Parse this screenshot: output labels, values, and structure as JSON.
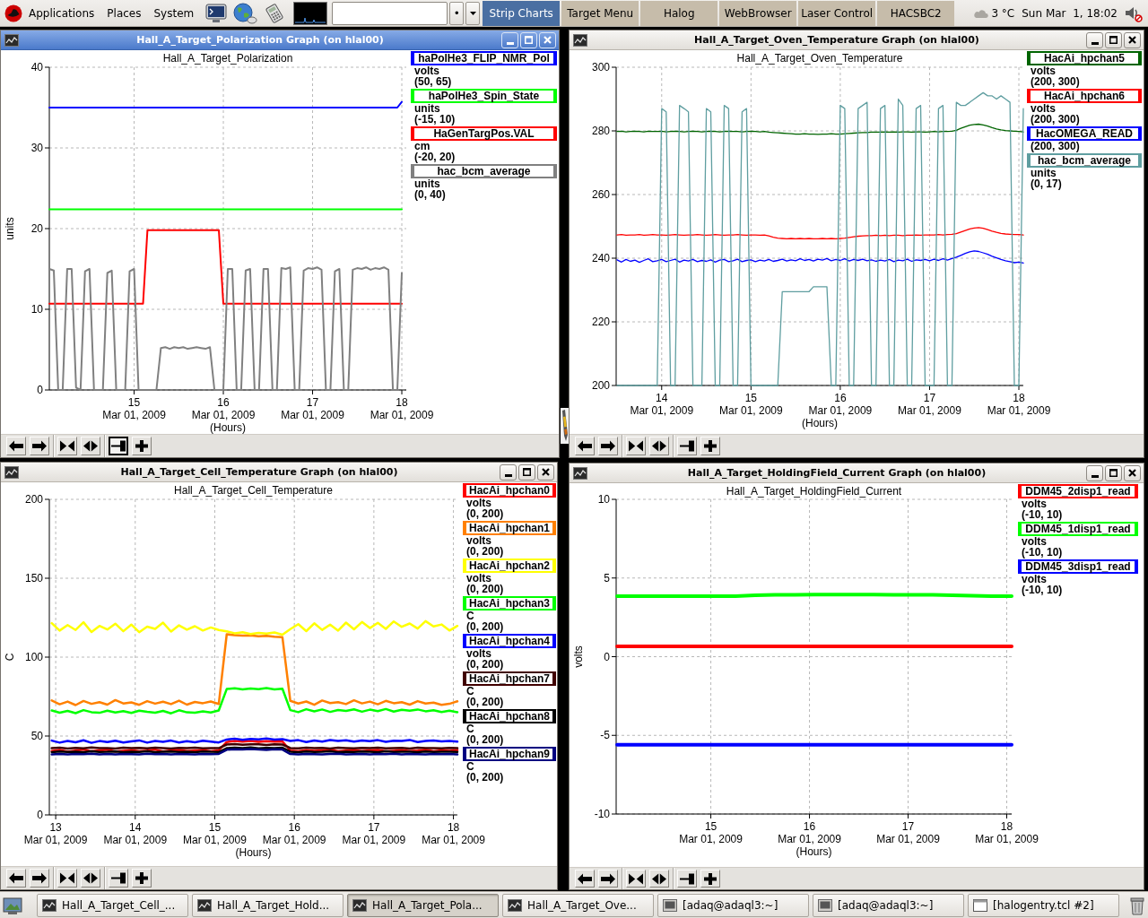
{
  "top_panel": {
    "menus": [
      "Applications",
      "Places",
      "System"
    ],
    "entry_button": "•",
    "workspaces": [
      {
        "label": "Strip Charts",
        "selected": true
      },
      {
        "label": "Target Menu",
        "selected": false
      },
      {
        "label": "Halog",
        "selected": false
      },
      {
        "label": "WebBrowser",
        "selected": false
      },
      {
        "label": "Laser Control",
        "selected": false
      },
      {
        "label": "HACSBC2",
        "selected": false
      }
    ],
    "weather": "3 °C",
    "clock": "Sun Mar  1, 18:02"
  },
  "windows": [
    {
      "title": "Hall_A_Target_Polarization Graph (on hlal00)",
      "active": true,
      "chart_data": {
        "type": "line",
        "title": "Hall_A_Target_Polarization",
        "xlabel": "(Hours)",
        "ylabel": "units",
        "x": [
          14.05,
          14.1,
          14.15,
          14.2,
          14.25,
          14.3,
          14.35,
          14.4,
          14.45,
          14.5,
          14.55,
          14.6,
          14.65,
          14.7,
          14.75,
          14.8,
          14.85,
          14.9,
          14.95,
          15,
          15.05,
          15.1,
          15.15,
          15.2,
          15.25,
          15.3,
          15.35,
          15.4,
          15.45,
          15.5,
          15.55,
          15.6,
          15.65,
          15.7,
          15.75,
          15.8,
          15.85,
          15.9,
          15.95,
          16,
          16.05,
          16.1,
          16.15,
          16.2,
          16.25,
          16.3,
          16.35,
          16.4,
          16.45,
          16.5,
          16.55,
          16.6,
          16.65,
          16.7,
          16.75,
          16.8,
          16.85,
          16.9,
          16.95,
          17,
          17.05,
          17.1,
          17.15,
          17.2,
          17.25,
          17.3,
          17.35,
          17.4,
          17.45,
          17.5,
          17.55,
          17.6,
          17.65,
          17.7,
          17.75,
          17.8,
          17.85,
          17.9,
          17.95,
          18
        ],
        "series": [
          {
            "name": "haPolHe3_FLIP_NMR_Pol",
            "color": "#0000ff",
            "values": [
              35,
              35,
              35,
              35,
              35,
              35,
              35,
              35,
              35,
              35,
              35,
              35,
              35,
              35,
              35,
              35,
              35,
              35,
              35,
              35,
              35,
              35,
              35,
              35,
              35,
              35,
              35,
              35,
              35,
              35,
              35,
              35,
              35,
              35,
              35,
              35,
              35,
              35,
              35,
              35,
              35,
              35,
              35,
              35,
              35,
              35,
              35,
              35,
              35,
              35,
              35,
              35,
              35,
              35,
              35,
              35,
              35,
              35,
              35,
              35,
              35,
              35,
              35,
              35,
              35,
              35,
              35,
              35,
              35,
              35,
              35,
              35,
              35,
              35,
              35,
              35,
              35,
              35,
              35,
              35.7
            ]
          },
          {
            "name": "haPolHe3_Spin_State",
            "color": "#00ff00",
            "values": [
              22.4,
              22.4,
              22.4,
              22.4,
              22.4,
              22.4,
              22.4,
              22.4,
              22.4,
              22.4,
              22.4,
              22.4,
              22.4,
              22.4,
              22.4,
              22.4,
              22.4,
              22.4,
              22.4,
              22.4,
              22.4,
              22.4,
              22.4,
              22.4,
              22.4,
              22.4,
              22.4,
              22.4,
              22.4,
              22.4,
              22.4,
              22.4,
              22.4,
              22.4,
              22.4,
              22.4,
              22.4,
              22.4,
              22.4,
              22.4,
              22.4,
              22.4,
              22.4,
              22.4,
              22.4,
              22.4,
              22.4,
              22.4,
              22.4,
              22.4,
              22.4,
              22.4,
              22.4,
              22.4,
              22.4,
              22.4,
              22.4,
              22.4,
              22.4,
              22.4,
              22.4,
              22.4,
              22.4,
              22.4,
              22.4,
              22.4,
              22.4,
              22.4,
              22.4,
              22.4,
              22.4,
              22.4,
              22.4,
              22.4,
              22.4,
              22.4,
              22.4,
              22.4,
              22.4,
              22.4
            ]
          },
          {
            "name": "HaGenTargPos.VAL",
            "color": "#ff0000",
            "values": [
              10.7,
              10.7,
              10.7,
              10.7,
              10.7,
              10.7,
              10.7,
              10.7,
              10.7,
              10.7,
              10.7,
              10.7,
              10.7,
              10.7,
              10.7,
              10.7,
              10.7,
              10.7,
              10.7,
              10.7,
              10.7,
              10.7,
              19.8,
              19.8,
              19.8,
              19.8,
              19.8,
              19.8,
              19.8,
              19.8,
              19.8,
              19.8,
              19.8,
              19.8,
              19.8,
              19.8,
              19.8,
              19.8,
              19.8,
              10.7,
              10.7,
              10.7,
              10.7,
              10.7,
              10.7,
              10.7,
              10.7,
              10.7,
              10.7,
              10.7,
              10.7,
              10.7,
              10.7,
              10.7,
              10.7,
              10.7,
              10.7,
              10.7,
              10.7,
              10.7,
              10.7,
              10.7,
              10.7,
              10.7,
              10.7,
              10.7,
              10.7,
              10.7,
              10.7,
              10.7,
              10.7,
              10.7,
              10.7,
              10.7,
              10.7,
              10.7,
              10.7,
              10.7,
              10.7,
              10.7
            ]
          },
          {
            "name": "hac_bcm_average",
            "color": "#808080",
            "values": [
              15,
              14.8,
              0,
              0,
              15,
              15,
              0.3,
              0,
              14.7,
              15,
              0,
              0,
              0,
              14.5,
              14.8,
              0,
              0,
              0,
              14.7,
              15,
              0,
              0,
              0,
              0,
              0,
              5.2,
              5.3,
              5.1,
              5.3,
              5.2,
              5.3,
              5.1,
              5.2,
              5.3,
              5.2,
              5.1,
              5.3,
              0,
              0,
              0,
              15,
              15,
              0,
              0,
              14.8,
              15,
              0,
              0,
              15,
              15,
              0,
              0,
              15.1,
              15,
              15.2,
              0,
              0,
              14.8,
              15.1,
              15,
              15.2,
              14.9,
              0,
              0,
              14.7,
              15,
              0,
              0,
              14.9,
              15.1,
              15,
              15.2,
              14.9,
              15.1,
              15,
              15.2,
              14.9,
              0,
              0,
              14.5
            ]
          }
        ],
        "xlim": [
          14.05,
          18.05
        ],
        "ylim": [
          0,
          40
        ],
        "xticks": [
          15,
          16,
          17,
          18
        ],
        "yticks": [
          0,
          10,
          20,
          30,
          40
        ],
        "grid": true
      },
      "tick_dates": [
        "Mar 01, 2009",
        "Mar 01, 2009",
        "Mar 01, 2009",
        "Mar 01, 2009"
      ],
      "legend": [
        {
          "unit": "volts",
          "range": "(50, 65)",
          "selected": false
        },
        {
          "unit": "units",
          "range": "(-15, 10)",
          "selected": false
        },
        {
          "unit": "cm",
          "range": "(-20, 20)",
          "selected": false
        },
        {
          "unit": "units",
          "range": "(0, 40)",
          "selected": true
        }
      ],
      "toolbar": [
        {
          "kind": "pan-left",
          "pressed": false
        },
        {
          "kind": "pan-right",
          "pressed": false
        },
        {
          "kind": "zoom-in",
          "pressed": false
        },
        {
          "kind": "zoom-out",
          "pressed": false
        },
        {
          "kind": "auto-scroll",
          "pressed": true
        },
        {
          "kind": "add",
          "pressed": false
        }
      ]
    },
    {
      "title": "Hall_A_Target_Oven_Temperature Graph (on hlal00)",
      "active": false,
      "chart_data": {
        "type": "line",
        "title": "Hall_A_Target_Oven_Temperature",
        "xlabel": "(Hours)",
        "x": [
          13.5,
          13.55,
          13.6,
          13.65,
          13.7,
          13.75,
          13.8,
          13.85,
          13.9,
          13.95,
          14,
          14.05,
          14.1,
          14.15,
          14.2,
          14.25,
          14.3,
          14.35,
          14.4,
          14.45,
          14.5,
          14.55,
          14.6,
          14.65,
          14.7,
          14.75,
          14.8,
          14.85,
          14.9,
          14.95,
          15,
          15.05,
          15.1,
          15.15,
          15.2,
          15.25,
          15.3,
          15.35,
          15.4,
          15.45,
          15.5,
          15.55,
          15.6,
          15.65,
          15.7,
          15.75,
          15.8,
          15.85,
          15.9,
          15.95,
          16,
          16.05,
          16.1,
          16.15,
          16.2,
          16.25,
          16.3,
          16.35,
          16.4,
          16.45,
          16.5,
          16.55,
          16.6,
          16.65,
          16.7,
          16.75,
          16.8,
          16.85,
          16.9,
          16.95,
          17,
          17.05,
          17.1,
          17.15,
          17.2,
          17.25,
          17.3,
          17.35,
          17.4,
          17.45,
          17.5,
          17.55,
          17.6,
          17.65,
          17.7,
          17.75,
          17.8,
          17.85,
          17.9,
          17.95,
          18,
          18.05
        ],
        "series": [
          {
            "name": "HacAi_hpchan5",
            "color": "#006400",
            "values": [
              279.8,
              279.9,
              279.7,
              279.8,
              279.9,
              279.8,
              279.7,
              279.9,
              279.8,
              279.8,
              279.9,
              279.7,
              279.8,
              279.9,
              279.8,
              279.7,
              279.8,
              279.9,
              279.8,
              279.7,
              279.8,
              279.9,
              279.8,
              279.7,
              279.8,
              279.9,
              279.8,
              279.8,
              279.7,
              279.8,
              279.9,
              279.8,
              279.7,
              279.8,
              279.6,
              279.5,
              279.4,
              279.3,
              279.2,
              279.1,
              279.0,
              279.0,
              279.1,
              279.0,
              279.0,
              278.9,
              279.0,
              279.0,
              279.1,
              279.0,
              279.0,
              279.1,
              279.2,
              279.3,
              279.4,
              279.5,
              279.5,
              279.6,
              279.6,
              279.6,
              279.7,
              279.6,
              279.7,
              279.6,
              279.7,
              279.7,
              279.6,
              279.7,
              279.7,
              279.6,
              279.7,
              279.8,
              279.7,
              279.8,
              279.8,
              279.9,
              280.2,
              280.8,
              281.3,
              281.8,
              282.0,
              282.1,
              281.9,
              281.5,
              281.0,
              280.6,
              280.3,
              280.1,
              280.0,
              279.9,
              279.8,
              279.7
            ]
          },
          {
            "name": "HacAi_hpchan6",
            "color": "#ff0000",
            "values": [
              247.3,
              247.4,
              247.2,
              247.3,
              247.3,
              247.4,
              247.2,
              247.3,
              247.4,
              247.3,
              247.3,
              247.2,
              247.3,
              247.4,
              247.3,
              247.2,
              247.3,
              247.3,
              247.4,
              247.3,
              247.2,
              247.3,
              247.4,
              247.3,
              247.2,
              247.3,
              247.3,
              247.4,
              247.3,
              247.2,
              247.3,
              247.3,
              247.2,
              247.3,
              247.0,
              246.6,
              246.3,
              246.2,
              246.1,
              246.2,
              246.1,
              246.2,
              246.1,
              246.2,
              246.1,
              246.1,
              246.2,
              246.1,
              246.2,
              246.1,
              246.2,
              246.3,
              246.5,
              246.7,
              246.9,
              247.0,
              247.1,
              247.1,
              247.2,
              247.1,
              247.2,
              247.1,
              247.2,
              247.2,
              247.1,
              247.2,
              247.2,
              247.3,
              247.2,
              247.3,
              247.3,
              247.3,
              247.4,
              247.3,
              247.4,
              247.5,
              247.7,
              248.2,
              248.7,
              249.2,
              249.5,
              249.6,
              249.4,
              249.0,
              248.5,
              248.1,
              247.8,
              247.6,
              247.5,
              247.4,
              247.4,
              247.3
            ]
          },
          {
            "name": "HacOMEGA_READ",
            "color": "#0000ff",
            "values": [
              239.5,
              238.8,
              239.6,
              239.0,
              239.4,
              238.7,
              239.3,
              239.8,
              238.9,
              239.2,
              239.6,
              238.9,
              239.3,
              239.7,
              238.8,
              239.4,
              239.1,
              239.6,
              238.9,
              239.3,
              239.0,
              239.5,
              238.8,
              239.4,
              239.6,
              238.9,
              239.2,
              239.7,
              238.9,
              239.3,
              239.5,
              238.9,
              239.4,
              239.1,
              239.6,
              239.0,
              239.3,
              239.7,
              239.1,
              239.5,
              239.2,
              239.8,
              239.3,
              239.6,
              239.1,
              239.7,
              239.4,
              239.9,
              239.2,
              239.6,
              239.3,
              239.8,
              239.1,
              239.6,
              239.3,
              239.7,
              239.2,
              239.5,
              239.0,
              239.4,
              239.1,
              239.6,
              238.9,
              239.4,
              239.2,
              239.7,
              239.0,
              239.5,
              239.3,
              239.6,
              239.2,
              239.7,
              239.3,
              239.8,
              239.4,
              239.9,
              240.3,
              240.9,
              241.5,
              242.0,
              242.3,
              242.1,
              241.7,
              241.2,
              240.6,
              240.1,
              239.6,
              239.2,
              238.9,
              238.6,
              238.8,
              238.5
            ]
          },
          {
            "name": "hac_bcm_average",
            "color": "#5f9ea0",
            "values": [
              200,
              200,
              200,
              200,
              200,
              200,
              200,
              200,
              200,
              200,
              287,
              286,
              200,
              200,
              288,
              287,
              286,
              200,
              200,
              200,
              287,
              286,
              200,
              200,
              288,
              287,
              200,
              200,
              286,
              287,
              200,
              200,
              200,
              200,
              200,
              200,
              200,
              229.5,
              229.5,
              229.5,
              229.5,
              229.5,
              229.5,
              229.5,
              231,
              231,
              231,
              231,
              200,
              200,
              288,
              287,
              200,
              200,
              287,
              288,
              289,
              200,
              200,
              287,
              288,
              200,
              200,
              290,
              288,
              200,
              200,
              287,
              288,
              200,
              200,
              200,
              287,
              288,
              200,
              200,
              289,
              288,
              288,
              289,
              290,
              291,
              292,
              291,
              291,
              290,
              291,
              290,
              289,
              200,
              200,
              287
            ]
          }
        ],
        "xlim": [
          13.49,
          18.05
        ],
        "ylim": [
          200,
          300
        ],
        "xticks": [
          14,
          15,
          16,
          17,
          18
        ],
        "yticks": [
          200,
          220,
          240,
          260,
          280,
          300
        ],
        "grid": true
      },
      "tick_dates": [
        "Mar 01, 2009",
        "Mar 01, 2009",
        "Mar 01, 2009",
        "Mar 01, 2009",
        "Mar 01, 2009"
      ],
      "legend": [
        {
          "unit": "volts",
          "range": "(200, 300)",
          "selected": false
        },
        {
          "unit": "volts",
          "range": "(200, 300)",
          "selected": false
        },
        {
          "range": "(200, 300)",
          "selected": true
        },
        {
          "unit": "units",
          "range": "(0, 17)",
          "selected": false
        }
      ],
      "toolbar": [
        {
          "kind": "pan-left",
          "pressed": false
        },
        {
          "kind": "pan-right",
          "pressed": false
        },
        {
          "kind": "zoom-in",
          "pressed": false
        },
        {
          "kind": "zoom-out",
          "pressed": false
        },
        {
          "kind": "auto-scroll",
          "pressed": false
        },
        {
          "kind": "add",
          "pressed": false
        }
      ]
    },
    {
      "title": "Hall_A_Target_Cell_Temperature Graph (on hlal00)",
      "active": false,
      "chart_data": {
        "type": "line",
        "title": "Hall_A_Target_Cell_Temperature",
        "xlabel": "(Hours)",
        "ylabel": "C",
        "x": [
          12.95,
          13.05,
          13.15,
          13.25,
          13.35,
          13.45,
          13.55,
          13.65,
          13.75,
          13.85,
          13.95,
          14.05,
          14.15,
          14.25,
          14.35,
          14.45,
          14.55,
          14.65,
          14.75,
          14.85,
          14.95,
          15.05,
          15.15,
          15.25,
          15.35,
          15.45,
          15.55,
          15.65,
          15.75,
          15.85,
          15.95,
          16.05,
          16.15,
          16.25,
          16.35,
          16.45,
          16.55,
          16.65,
          16.75,
          16.85,
          16.95,
          17.05,
          17.15,
          17.25,
          17.35,
          17.45,
          17.55,
          17.65,
          17.75,
          17.85,
          17.95,
          18.05
        ],
        "series": [
          {
            "name": "HacAi_hpchan0",
            "color": "#ff0000",
            "values": [
              40.5,
              41.2,
              40.1,
              40.8,
              41.5,
              40.3,
              40.9,
              41.3,
              40.2,
              40.7,
              41.1,
              40.4,
              40.8,
              41.4,
              40.2,
              40.9,
              41.2,
              40.5,
              40.8,
              41.0,
              40.4,
              40.9,
              46.2,
              46.8,
              46.5,
              46.9,
              46.3,
              46.7,
              46.4,
              46.6,
              40.8,
              40.3,
              41.1,
              40.6,
              40.9,
              41.3,
              40.4,
              40.8,
              41.0,
              40.5,
              40.9,
              41.2,
              40.3,
              40.7,
              41.1,
              40.5,
              40.8,
              41.3,
              40.4,
              40.9,
              40.6,
              41.0
            ]
          },
          {
            "name": "HacAi_hpchan1",
            "color": "#ff8000",
            "values": [
              72.5,
              70.1,
              71.8,
              69.6,
              72.2,
              70.4,
              71.5,
              69.9,
              72.8,
              70.6,
              71.3,
              69.8,
              72.1,
              70.5,
              71.7,
              70.2,
              72.4,
              69.9,
              71.6,
              70.8,
              71.9,
              70.3,
              114.5,
              114.0,
              113.6,
              113.8,
              113.2,
              113.5,
              112.9,
              112.6,
              72.3,
              70.6,
              71.9,
              69.8,
              72.5,
              70.9,
              71.4,
              70.2,
              72.6,
              70.7,
              71.8,
              70.1,
              72.3,
              70.8,
              71.5,
              69.9,
              72.1,
              70.6,
              71.2,
              69.7,
              70.4,
              72.0
            ]
          },
          {
            "name": "HacAi_hpchan2",
            "color": "#ffff00",
            "values": [
              121.5,
              116.8,
              120.3,
              117.2,
              122.1,
              115.9,
              119.8,
              117.5,
              121.2,
              116.4,
              120.6,
              115.8,
              119.3,
              117.9,
              121.8,
              116.2,
              120.1,
              117.4,
              119.6,
              116.9,
              118.8,
              117.2,
              116.3,
              115.1,
              115.8,
              114.6,
              115.4,
              114.9,
              115.6,
              114.2,
              117.8,
              120.9,
              116.5,
              121.4,
              117.3,
              120.6,
              116.8,
              121.9,
              117.6,
              122.3,
              118.4,
              121.7,
              117.9,
              122.6,
              119.2,
              121.3,
              118.1,
              122.8,
              119.5,
              120.7,
              116.9,
              119.8
            ]
          },
          {
            "name": "HacAi_hpchan3",
            "color": "#00ff00",
            "values": [
              66.2,
              64.8,
              65.9,
              64.5,
              66.4,
              65.1,
              64.7,
              66.0,
              64.9,
              65.8,
              64.6,
              66.1,
              65.3,
              64.8,
              65.9,
              64.4,
              66.3,
              65.0,
              64.7,
              65.6,
              64.9,
              66.2,
              79.8,
              80.3,
              79.5,
              80.1,
              79.7,
              80.4,
              79.6,
              80.0,
              66.4,
              65.1,
              67.0,
              65.6,
              66.8,
              65.3,
              66.5,
              65.9,
              66.9,
              65.4,
              66.7,
              65.8,
              67.1,
              65.5,
              66.6,
              66.0,
              66.8,
              65.7,
              66.3,
              65.2,
              66.0,
              65.1
            ]
          },
          {
            "name": "HacAi_hpchan4",
            "color": "#0000ff",
            "values": [
              47.1,
              45.8,
              46.9,
              46.0,
              47.3,
              45.7,
              46.8,
              46.2,
              47.0,
              45.9,
              46.6,
              47.2,
              45.8,
              46.9,
              46.3,
              47.1,
              45.9,
              46.7,
              46.1,
              47.0,
              46.4,
              45.9,
              47.8,
              48.3,
              47.6,
              48.1,
              47.9,
              48.4,
              47.7,
              48.0,
              46.9,
              47.4,
              46.2,
              47.2,
              46.5,
              47.5,
              46.8,
              47.3,
              46.4,
              47.1,
              46.7,
              47.4,
              46.3,
              47.0,
              46.8,
              47.5,
              46.2,
              46.9,
              47.2,
              46.6,
              46.9,
              46.4
            ]
          },
          {
            "name": "HacAi_hpchan7",
            "color": "#400000",
            "values": [
              42.3,
              42.6,
              42.1,
              42.5,
              42.2,
              42.7,
              42.3,
              42.4,
              42.1,
              42.6,
              42.3,
              42.5,
              42.2,
              42.6,
              42.4,
              42.1,
              42.5,
              42.3,
              42.6,
              42.2,
              42.4,
              42.3,
              44.6,
              44.9,
              44.5,
              44.8,
              44.7,
              44.4,
              44.8,
              44.6,
              42.4,
              42.2,
              42.6,
              42.3,
              42.5,
              42.1,
              42.6,
              42.4,
              42.2,
              42.5,
              42.3,
              42.6,
              42.2,
              42.4,
              42.5,
              42.1,
              42.6,
              42.3,
              42.4,
              42.2,
              42.5,
              42.3
            ]
          },
          {
            "name": "HacAi_hpchan8",
            "color": "#000000",
            "values": [
              39.8,
              40.2,
              39.9,
              40.1,
              39.7,
              40.3,
              39.9,
              40.0,
              40.2,
              39.8,
              40.1,
              39.9,
              40.3,
              39.8,
              40.0,
              40.2,
              39.9,
              40.1,
              39.8,
              40.2,
              40.0,
              39.9,
              42.3,
              42.6,
              42.4,
              42.7,
              42.2,
              42.5,
              42.4,
              42.6,
              40.1,
              39.8,
              40.2,
              39.9,
              40.0,
              40.3,
              39.8,
              40.1,
              39.9,
              40.2,
              40.0,
              39.8,
              40.3,
              39.9,
              40.1,
              40.0,
              39.8,
              40.2,
              39.9,
              40.1,
              40.0,
              39.9
            ]
          },
          {
            "name": "HacAi_hpchan9",
            "color": "#000080",
            "values": [
              38.4,
              38.7,
              38.3,
              38.6,
              38.5,
              38.8,
              38.4,
              38.6,
              38.3,
              38.7,
              38.5,
              38.4,
              38.8,
              38.5,
              38.6,
              38.3,
              38.7,
              38.5,
              38.4,
              38.6,
              38.5,
              38.7,
              41.3,
              41.6,
              41.4,
              41.7,
              41.5,
              41.2,
              41.6,
              41.4,
              38.6,
              38.4,
              38.7,
              38.5,
              38.3,
              38.6,
              38.8,
              38.4,
              38.5,
              38.7,
              38.3,
              38.6,
              38.5,
              38.8,
              38.4,
              38.6,
              38.5,
              38.3,
              38.7,
              38.5,
              38.6,
              38.4
            ]
          }
        ],
        "xlim": [
          12.92,
          18.05
        ],
        "ylim": [
          0,
          200
        ],
        "xticks": [
          13,
          14,
          15,
          16,
          17,
          18
        ],
        "yticks": [
          0,
          50,
          100,
          150,
          200
        ],
        "grid": true
      },
      "tick_dates": [
        "Mar 01, 2009",
        "Mar 01, 2009",
        "Mar 01, 2009",
        "Mar 01, 2009",
        "Mar 01, 2009",
        "Mar 01, 2009"
      ],
      "legend": [
        {
          "unit": "volts",
          "range": "(0, 200)",
          "selected": false
        },
        {
          "unit": "volts",
          "range": "(0, 200)",
          "selected": false
        },
        {
          "unit": "volts",
          "range": "(0, 200)",
          "selected": false
        },
        {
          "unit": "C",
          "range": "(0, 200)",
          "selected": false
        },
        {
          "unit": "volts",
          "range": "(0, 200)",
          "selected": false
        },
        {
          "unit": "C",
          "range": "(0, 200)",
          "selected": true
        },
        {
          "unit": "C",
          "range": "(0, 200)",
          "selected": false
        },
        {
          "unit": "C",
          "range": "(0, 200)",
          "selected": false
        }
      ],
      "toolbar": [
        {
          "kind": "pan-left",
          "pressed": false
        },
        {
          "kind": "pan-right",
          "pressed": false
        },
        {
          "kind": "zoom-in",
          "pressed": false
        },
        {
          "kind": "zoom-out",
          "pressed": false
        },
        {
          "kind": "auto-scroll",
          "pressed": false
        },
        {
          "kind": "add",
          "pressed": false
        }
      ]
    },
    {
      "title": "Hall_A_Target_HoldingField_Current Graph (on hlal00)",
      "active": false,
      "chart_data": {
        "type": "line",
        "title": "Hall_A_Target_HoldingField_Current",
        "xlabel": "(Hours)",
        "ylabel": "volts",
        "x": [
          14.05,
          14.25,
          14.45,
          14.65,
          14.85,
          15.05,
          15.25,
          15.45,
          15.65,
          15.85,
          16.05,
          16.25,
          16.45,
          16.65,
          16.85,
          17.05,
          17.25,
          17.45,
          17.65,
          17.85,
          18.05
        ],
        "series": [
          {
            "name": "DDM45_2disp1_read",
            "color": "#ff0000",
            "values": [
              0.65,
              0.65,
              0.65,
              0.65,
              0.65,
              0.65,
              0.65,
              0.65,
              0.65,
              0.65,
              0.65,
              0.65,
              0.65,
              0.65,
              0.65,
              0.65,
              0.65,
              0.65,
              0.65,
              0.65,
              0.65
            ]
          },
          {
            "name": "DDM45_1disp1_read",
            "color": "#00ff00",
            "values": [
              3.85,
              3.85,
              3.85,
              3.85,
              3.85,
              3.85,
              3.85,
              3.9,
              3.93,
              3.94,
              3.95,
              3.95,
              3.95,
              3.95,
              3.94,
              3.94,
              3.93,
              3.9,
              3.88,
              3.85,
              3.85
            ]
          },
          {
            "name": "DDM45_3disp1_read",
            "color": "#0000ff",
            "values": [
              -5.6,
              -5.6,
              -5.6,
              -5.6,
              -5.6,
              -5.6,
              -5.6,
              -5.6,
              -5.6,
              -5.6,
              -5.6,
              -5.6,
              -5.6,
              -5.6,
              -5.6,
              -5.6,
              -5.6,
              -5.6,
              -5.6,
              -5.6,
              -5.6
            ]
          }
        ],
        "xlim": [
          14.04,
          18.05
        ],
        "ylim": [
          -10,
          10
        ],
        "xticks": [
          15,
          16,
          17,
          18
        ],
        "yticks": [
          -10,
          -5,
          0,
          5,
          10
        ],
        "grid": true
      },
      "tick_dates": [
        "Mar 01, 2009",
        "Mar 01, 2009",
        "Mar 01, 2009",
        "Mar 01, 2009"
      ],
      "legend": [
        {
          "unit": "volts",
          "range": "(-10, 10)",
          "selected": true
        },
        {
          "unit": "volts",
          "range": "(-10, 10)",
          "selected": false
        },
        {
          "unit": "volts",
          "range": "(-10, 10)",
          "selected": false
        }
      ],
      "toolbar": [
        {
          "kind": "pan-left",
          "pressed": false
        },
        {
          "kind": "pan-right",
          "pressed": false
        },
        {
          "kind": "zoom-in",
          "pressed": false
        },
        {
          "kind": "zoom-out",
          "pressed": false
        },
        {
          "kind": "auto-scroll",
          "pressed": false
        },
        {
          "kind": "add",
          "pressed": false
        }
      ]
    }
  ],
  "taskbar": {
    "tasks": [
      {
        "label": "Hall_A_Target_Cell_...",
        "kind": "graph",
        "selected": false
      },
      {
        "label": "Hall_A_Target_Hold...",
        "kind": "graph",
        "selected": false
      },
      {
        "label": "Hall_A_Target_Pola...",
        "kind": "graph",
        "selected": true
      },
      {
        "label": "Hall_A_Target_Ove...",
        "kind": "graph",
        "selected": false
      },
      {
        "label": "[adaq@adaql3:~]",
        "kind": "terminal",
        "selected": false
      },
      {
        "label": "[adaq@adaql3:~]",
        "kind": "terminal",
        "selected": false
      },
      {
        "label": "[halogentry.tcl #2]",
        "kind": "window",
        "selected": false
      }
    ]
  }
}
